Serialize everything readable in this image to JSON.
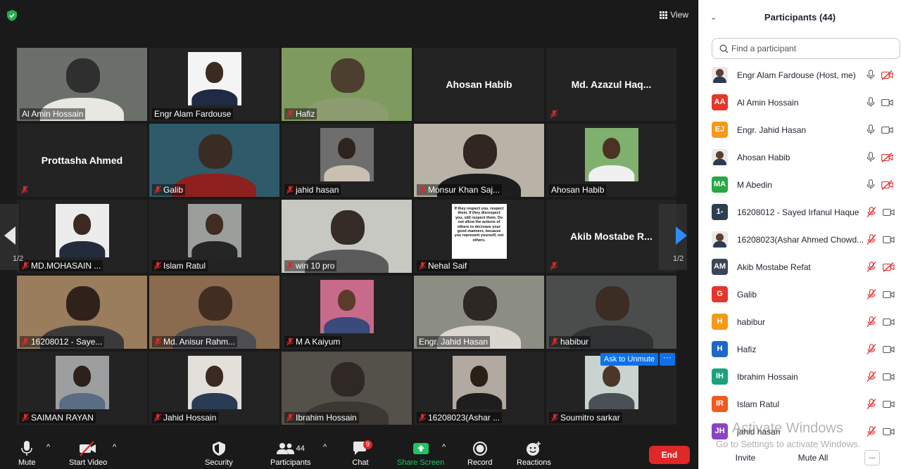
{
  "meeting": {
    "view_label": "View",
    "page_indicator": "1/2",
    "page_indicator_right": "1/2",
    "ask_to_unmute": "Ask to Unmute",
    "more_label": "···"
  },
  "tiles": [
    {
      "name": "Al Amin Hossain",
      "kind": "video",
      "muted": false,
      "active": true,
      "colors": [
        "#6b6f6a",
        "#2b2b2b",
        "#e9e7e1"
      ]
    },
    {
      "name": "Engr Alam Fardouse",
      "kind": "photo",
      "muted": false,
      "colors": [
        "#f4f4f4",
        "#3b2a20",
        "#1f2a44"
      ]
    },
    {
      "name": "Hafiz",
      "kind": "video",
      "muted": true,
      "colors": [
        "#7e9a5f",
        "#4a3a2c",
        "#8c9c70"
      ]
    },
    {
      "name": "Ahosan Habib",
      "kind": "name",
      "muted": false
    },
    {
      "name": "Md. Azazul Haq...",
      "kind": "name",
      "muted": true
    },
    {
      "name": "Prottasha Ahmed",
      "kind": "name",
      "muted": true
    },
    {
      "name": "Galib",
      "kind": "video",
      "muted": true,
      "colors": [
        "#2f5a6a",
        "#3b2a22",
        "#8e2020"
      ]
    },
    {
      "name": "jahid hasan",
      "kind": "photo",
      "muted": true,
      "colors": [
        "#6e6e6e",
        "#2e241e",
        "#c9c0b1"
      ]
    },
    {
      "name": "Monsur Khan Saj...",
      "kind": "video",
      "muted": true,
      "colors": [
        "#b9b2a6",
        "#2a1f1a",
        "#1d1d1d"
      ]
    },
    {
      "name": "Ahosan Habib",
      "kind": "photo",
      "muted": false,
      "colors": [
        "#7fb06e",
        "#4b3225",
        "#f0f0f0"
      ]
    },
    {
      "name": "MD.MOHASAIN ...",
      "kind": "photo",
      "muted": true,
      "colors": [
        "#ececec",
        "#3a2a20",
        "#232b3d"
      ]
    },
    {
      "name": "Islam Ratul",
      "kind": "photo",
      "muted": true,
      "colors": [
        "#9a9f9b",
        "#3f2c22",
        "#252525"
      ]
    },
    {
      "name": "win 10 pro",
      "kind": "video",
      "muted": true,
      "colors": [
        "#c7c8c2",
        "#2d2420",
        "#5b5b5b"
      ]
    },
    {
      "name": "Nehal Saif",
      "kind": "poster",
      "muted": true,
      "poster_text": "If they respect you, respect them. If they disrespect you, still respect them. Do not allow the actions of others to decrease your good manners, because you represent yourself, not others."
    },
    {
      "name": "Akib Mostabe R...",
      "kind": "name",
      "muted": true
    },
    {
      "name": "16208012 - Saye...",
      "kind": "video",
      "muted": true,
      "colors": [
        "#9a7d5c",
        "#2a1d17",
        "#3a3a3a"
      ]
    },
    {
      "name": "Md. Anisur Rahm...",
      "kind": "video",
      "muted": true,
      "colors": [
        "#8a6b4f",
        "#3d2a20",
        "#4e4e52"
      ]
    },
    {
      "name": "M A Kaiyum",
      "kind": "photo",
      "muted": true,
      "colors": [
        "#c86a8a",
        "#5b3c2c",
        "#3a4a7a"
      ]
    },
    {
      "name": "Engr. Jahid Hasan",
      "kind": "video",
      "muted": false,
      "colors": [
        "#8c8d83",
        "#2a2220",
        "#d9d6d0"
      ]
    },
    {
      "name": "habibur",
      "kind": "video",
      "muted": true,
      "colors": [
        "#4a4d4c",
        "#3a2a22",
        "#2f3133"
      ]
    },
    {
      "name": "SAIMAN RAYAN",
      "kind": "photo",
      "muted": true,
      "colors": [
        "#9c9ea0",
        "#2c211b",
        "#5b6d85"
      ]
    },
    {
      "name": "Jahid Hossain",
      "kind": "photo",
      "muted": true,
      "colors": [
        "#e3e0db",
        "#3a2a22",
        "#2a3c55"
      ]
    },
    {
      "name": "Ibrahim Hossain",
      "kind": "video",
      "muted": true,
      "colors": [
        "#54504a",
        "#2e2622",
        "#3b3733"
      ]
    },
    {
      "name": "16208023(Ashar ...",
      "kind": "photo",
      "muted": true,
      "colors": [
        "#b2aaa1",
        "#2a1f19",
        "#1e1e1e"
      ]
    },
    {
      "name": "Soumitro sarkar",
      "kind": "photo",
      "muted": true,
      "ask_unmute": true,
      "colors": [
        "#c9d3cf",
        "#4b3729",
        "#4a4f57"
      ]
    }
  ],
  "toolbar": {
    "mute": "Mute",
    "start_video": "Start Video",
    "security": "Security",
    "participants": "Participants",
    "participants_count": "44",
    "chat": "Chat",
    "chat_badge": "9",
    "share_screen": "Share Screen",
    "record": "Record",
    "reactions": "Reactions",
    "end": "End",
    "share_color": "#21c464",
    "end_color": "#e02828"
  },
  "panel": {
    "title": "Participants (44)",
    "search_placeholder": "Find a participant",
    "invite": "Invite",
    "mute_all": "Mute All",
    "more": "..."
  },
  "participants": [
    {
      "name": "Engr Alam Fardouse (Host, me)",
      "avatar": "photo",
      "mic": "on",
      "video": "off"
    },
    {
      "name": "Al Amin Hossain",
      "avatar": "AA",
      "color": "#e5362b",
      "mic": "on",
      "video": "on"
    },
    {
      "name": "Engr. Jahid Hasan",
      "avatar": "EJ",
      "color": "#f39a1b",
      "mic": "on",
      "video": "on"
    },
    {
      "name": "Ahosan Habib",
      "avatar": "photo",
      "mic": "on",
      "video": "off"
    },
    {
      "name": "M Abedin",
      "avatar": "MA",
      "color": "#28a745",
      "mic": "on",
      "video": "off"
    },
    {
      "name": "16208012 - Sayed Irfanul Haque",
      "avatar": "1-",
      "color": "#2d3e50",
      "mic": "off",
      "video": "on"
    },
    {
      "name": "16208023(Ashar Ahmed Chowd...",
      "avatar": "photo",
      "mic": "off",
      "video": "on"
    },
    {
      "name": "Akib Mostabe Refat",
      "avatar": "AM",
      "color": "#3b4656",
      "mic": "off",
      "video": "off"
    },
    {
      "name": "Galib",
      "avatar": "G",
      "color": "#e5362b",
      "mic": "off",
      "video": "on"
    },
    {
      "name": "habibur",
      "avatar": "H",
      "color": "#f39a1b",
      "mic": "off",
      "video": "on"
    },
    {
      "name": "Hafiz",
      "avatar": "H",
      "color": "#1e67c4",
      "mic": "off",
      "video": "on"
    },
    {
      "name": "Ibrahim Hossain",
      "avatar": "IH",
      "color": "#1aa37a",
      "mic": "off",
      "video": "on"
    },
    {
      "name": "Islam Ratul",
      "avatar": "IR",
      "color": "#ee5a1f",
      "mic": "off",
      "video": "on"
    },
    {
      "name": "jahid hasan",
      "avatar": "JH",
      "color": "#8a45c2",
      "mic": "off",
      "video": "on"
    }
  ],
  "watermark": {
    "line1": "Activate Windows",
    "line2": "Go to Settings to activate Windows."
  }
}
